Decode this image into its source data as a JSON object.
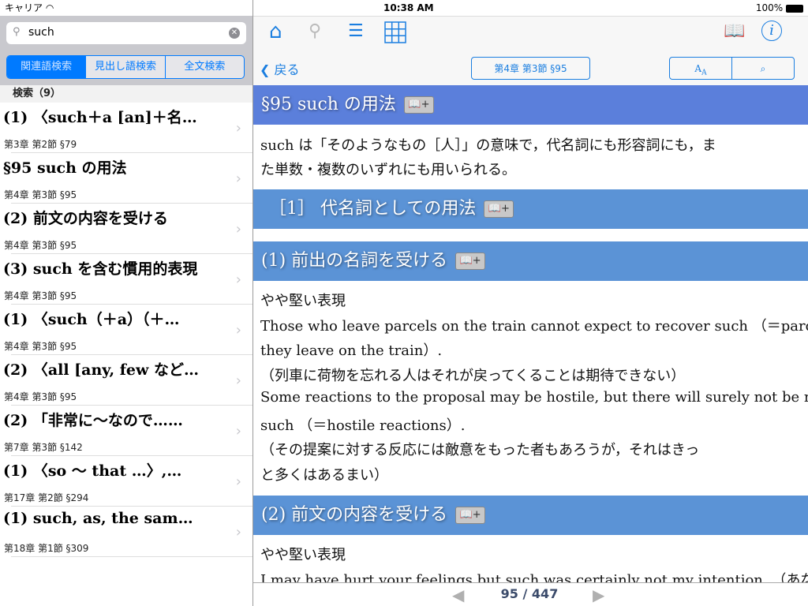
{
  "status": {
    "carrier": "キャリア",
    "time": "10:38 AM",
    "battery": "100%"
  },
  "search": {
    "value": "such",
    "clear_icon": "clear-icon"
  },
  "segments": [
    "関連語検索",
    "見出し語検索",
    "全文検索"
  ],
  "list_header": "検索（9）",
  "results": [
    {
      "title": "(1) 〈such＋a [an]＋名…",
      "sub": "第3章 第2節 §79"
    },
    {
      "title": "§95 such の用法",
      "sub": "第4章 第3節 §95"
    },
    {
      "title": "(2) 前文の内容を受ける",
      "sub": "第4章 第3節 §95"
    },
    {
      "title": "(3) such を含む慣用的表現",
      "sub": "第4章 第3節 §95"
    },
    {
      "title": "(1) 〈such（＋a）（＋…",
      "sub": "第4章 第3節 §95"
    },
    {
      "title": "(2) 〈all [any, few など…",
      "sub": "第4章 第3節 §95"
    },
    {
      "title": "(2) 「非常に～なので……",
      "sub": "第7章 第3節 §142"
    },
    {
      "title": "(1) 〈so ～ that …〉,…",
      "sub": "第17章 第2節 §294"
    },
    {
      "title": "(1) such, as, the sam…",
      "sub": "第18章 第1節 §309"
    }
  ],
  "toolbar": {
    "back": "戻る",
    "location": "第4章 第3節 §95",
    "font_size": "AA",
    "bookmark_add": "📖+"
  },
  "content": {
    "h1": "§95 such の用法",
    "p1": [
      "such は「そのようなもの［人］」の意味で，代名詞にも形容詞にも，ま",
      "た単数・複数のいずれにも用いられる。"
    ],
    "h2": "［1］ 代名詞としての用法",
    "h3": "(1) 前出の名詞を受ける",
    "p2": [
      "やや堅い表現",
      "Those who leave parcels on the train cannot expect to recover such （＝parcels",
      "they leave on the train）.",
      "（列車に荷物を忘れる人はそれが戻ってくることは期待できない）",
      "Some reactions to the proposal may be hostile, but there will surely not be many",
      "such （＝hostile reactions）.",
      "（その提案に対する反応には敵意をもった者もあろうが，それはきっ",
      "と多くはあるまい）"
    ],
    "h4": "(2) 前文の内容を受ける",
    "p3": [
      "やや堅い表現",
      "I may have hurt your feelings but such was certainly not my intention. （あなた"
    ]
  },
  "pager": {
    "label": "95 / 447"
  },
  "colors": {
    "accent": "#007aff",
    "h1_bg": "#5b7fdb",
    "h2_bg": "#5b93d6"
  }
}
